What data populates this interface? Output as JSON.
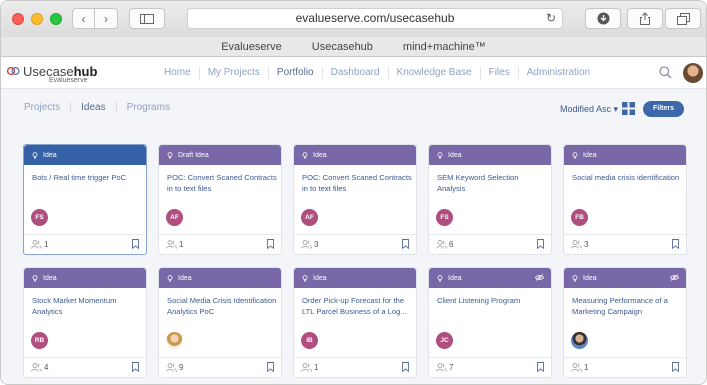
{
  "browser": {
    "url": "evalueserve.com/usecasehub",
    "bookmarks": [
      "Evalueserve",
      "Usecasehub",
      "mind+machine™"
    ]
  },
  "app": {
    "logo_prefix": "Usecase",
    "logo_bold": "hub",
    "logo_sub": "Evalueserve",
    "nav": [
      "Home",
      "My Projects",
      "Portfolio",
      "Dashboard",
      "Knowledge Base",
      "Files",
      "Administration"
    ],
    "active_nav": "Portfolio"
  },
  "subtabs": [
    "Projects",
    "Ideas",
    "Programs"
  ],
  "active_subtab": "Ideas",
  "sort_label": "Modified Asc ▾",
  "filter_label": "Filters",
  "colors": {
    "header_purple": "#7868a8",
    "header_blue": "#3562a6",
    "avatar_pink": "#b04e7f",
    "filter_button": "#3d67a8"
  },
  "cards": [
    {
      "type": "Idea",
      "title": "Bots / Real time trigger PoC",
      "avatar": "FS",
      "count": "1",
      "selected": true,
      "eye": false
    },
    {
      "type": "Draft Idea",
      "title": "POC: Convert Scaned Contracts in to text files",
      "avatar": "AF",
      "count": "1",
      "eye": false
    },
    {
      "type": "Idea",
      "title": "POC: Convert Scaned Contracts in to text files",
      "avatar": "AF",
      "count": "3",
      "eye": false
    },
    {
      "type": "Idea",
      "title": "SEM Keyword Selection Analysis",
      "avatar": "FS",
      "count": "6",
      "eye": false
    },
    {
      "type": "Idea",
      "title": "Social media crisis identification",
      "avatar": "FB",
      "count": "3",
      "eye": false
    },
    {
      "type": "Idea",
      "title": "Stock Market Momentum Analytics",
      "avatar": "RB",
      "count": "4",
      "eye": false
    },
    {
      "type": "Idea",
      "title": "Social Media Crisis Identification Analytics PoC",
      "avatar": "",
      "photo": "female",
      "count": "9",
      "eye": false
    },
    {
      "type": "Idea",
      "title": "Order Pick-up Forecast for the LTL Parcel Business of a Log...",
      "avatar": "IB",
      "count": "1",
      "eye": false
    },
    {
      "type": "Idea",
      "title": "Client Listening Program",
      "avatar": "JC",
      "count": "7",
      "eye": true
    },
    {
      "type": "Idea",
      "title": "Measuring Performance of a Marketing Campaign",
      "avatar": "",
      "photo": "male",
      "count": "1",
      "eye": true
    }
  ]
}
